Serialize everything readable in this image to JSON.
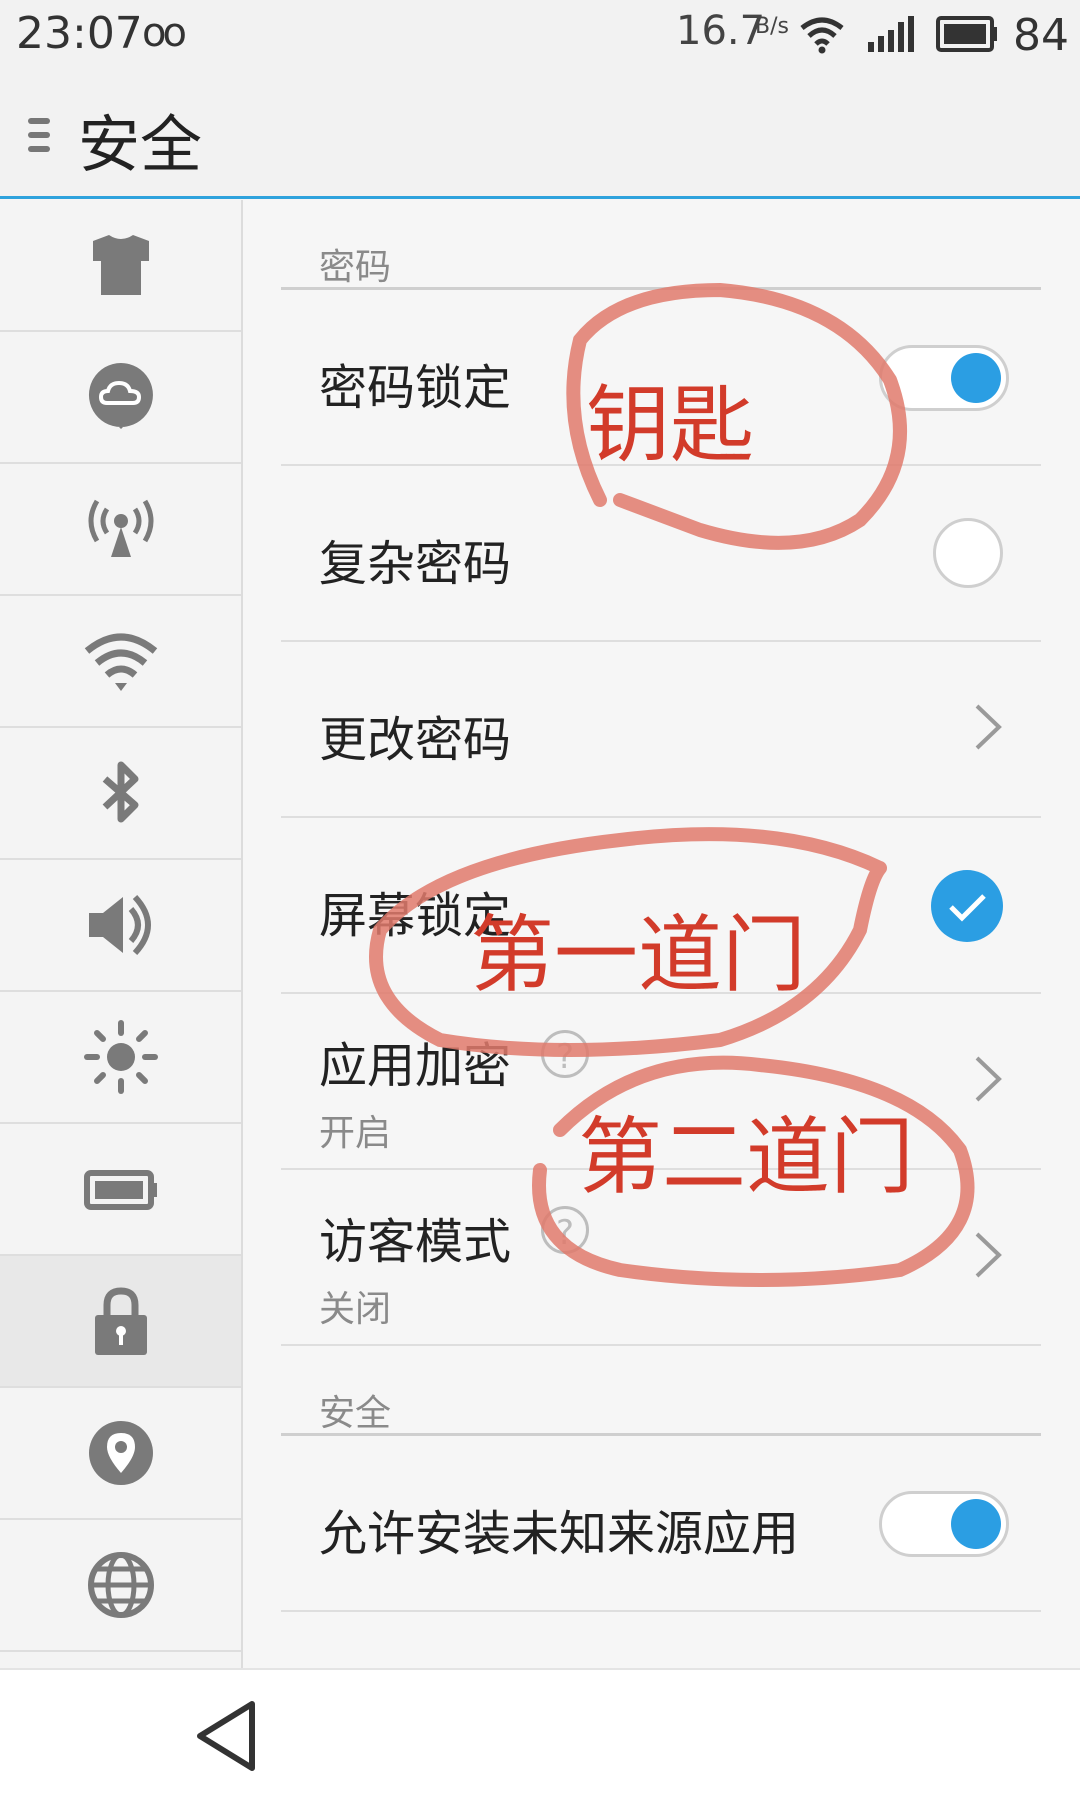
{
  "status_bar": {
    "time": "23:07",
    "infinity": "oo",
    "speed": "16.7",
    "speed_unit": "B/s",
    "battery": "84"
  },
  "header": {
    "title": "安全"
  },
  "sidebar": {
    "items": [
      {
        "icon": "shirt-icon"
      },
      {
        "icon": "cloud-icon"
      },
      {
        "icon": "hotspot-icon"
      },
      {
        "icon": "wifi-icon"
      },
      {
        "icon": "bluetooth-icon"
      },
      {
        "icon": "speaker-icon"
      },
      {
        "icon": "brightness-icon"
      },
      {
        "icon": "battery-icon"
      },
      {
        "icon": "lock-icon",
        "active": true
      },
      {
        "icon": "location-icon"
      },
      {
        "icon": "globe-icon"
      }
    ]
  },
  "sections": {
    "password": "密码",
    "security": "安全"
  },
  "rows": {
    "password_lock": {
      "label": "密码锁定",
      "on": true
    },
    "complex_password": {
      "label": "复杂密码",
      "on": false
    },
    "change_password": {
      "label": "更改密码"
    },
    "screen_lock": {
      "label": "屏幕锁定",
      "checked": true
    },
    "app_encrypt": {
      "label": "应用加密",
      "sub": "开启",
      "help": "?"
    },
    "guest_mode": {
      "label": "访客模式",
      "sub": "关闭",
      "help": "?"
    },
    "unknown_sources": {
      "label": "允许安装未知来源应用",
      "on": true
    }
  },
  "annotations": {
    "key": "钥匙",
    "first_door": "第一道门",
    "second_door": "第二道门"
  },
  "colors": {
    "accent": "#2b9ee3",
    "annotation": "#d23b2a"
  }
}
